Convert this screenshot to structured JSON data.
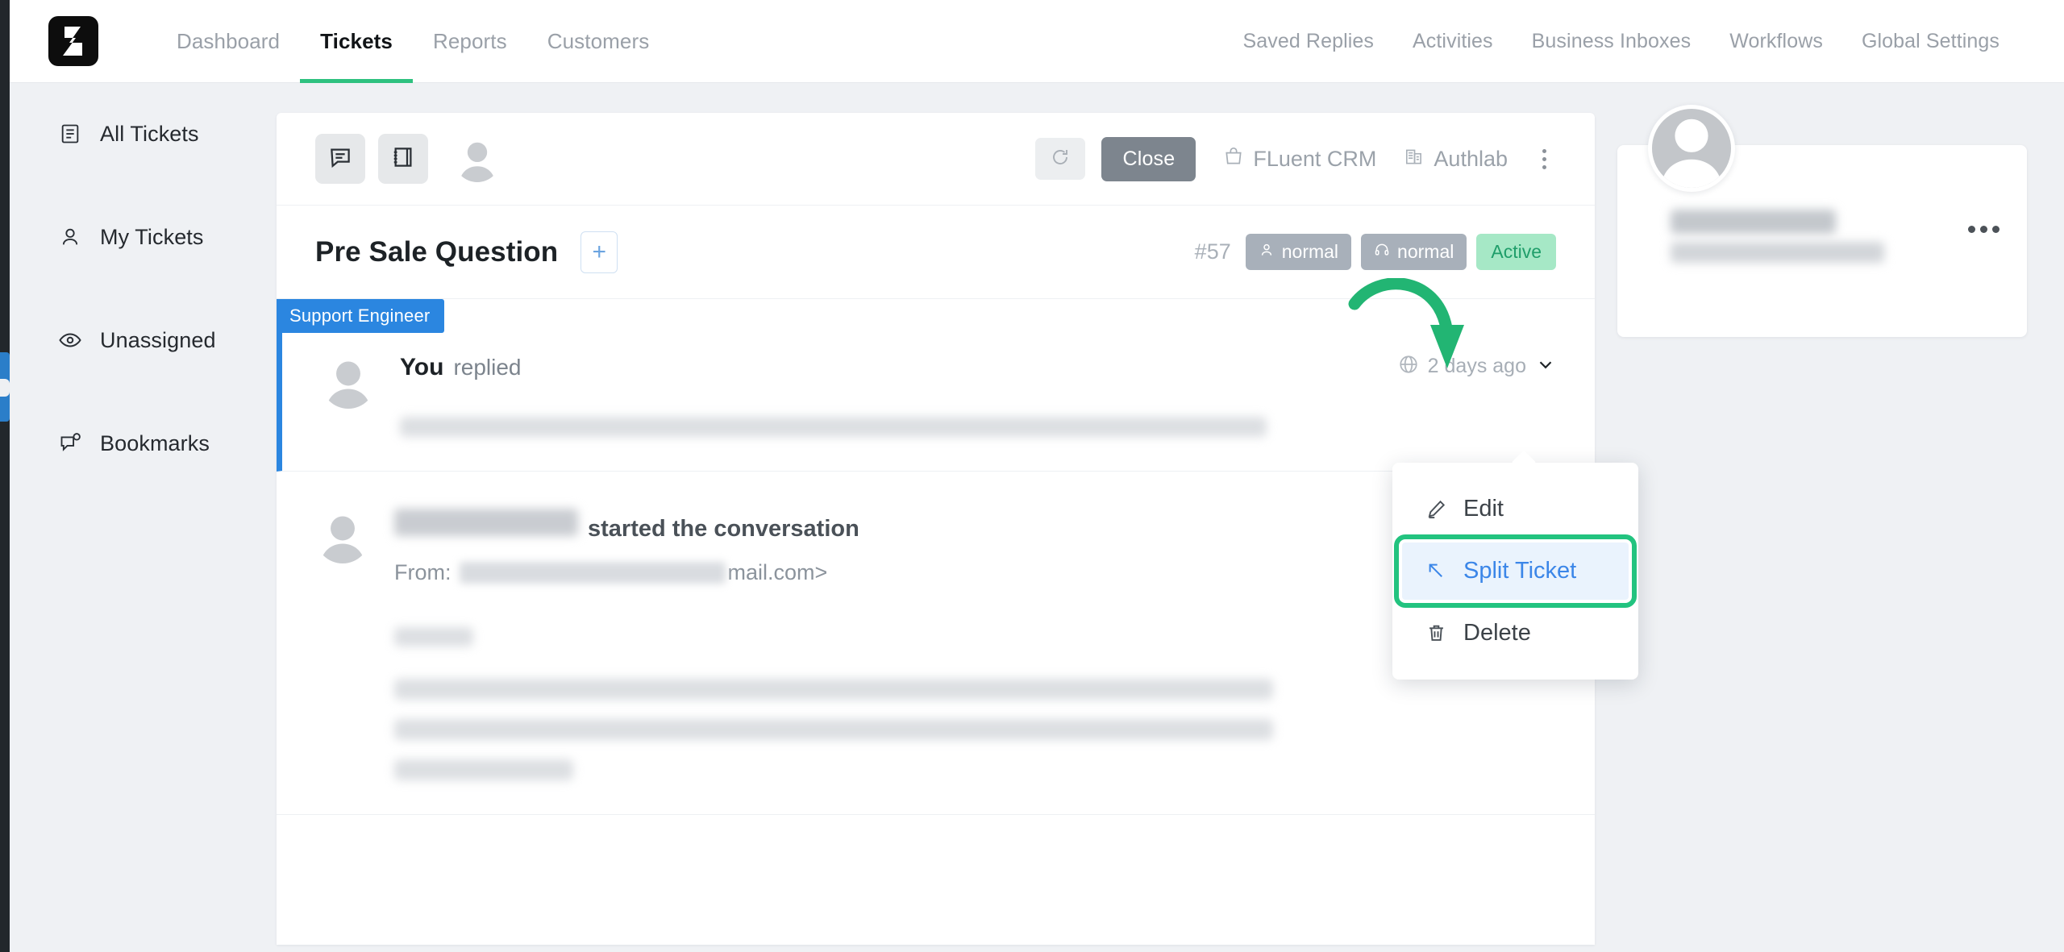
{
  "brand": {
    "logo_icon": "fluent-support-logo",
    "accent_green": "#2ec17f",
    "accent_blue": "#2b86e0",
    "highlight_green": "#22c37f"
  },
  "topnav": {
    "left_items": [
      {
        "label": "Dashboard",
        "active": false
      },
      {
        "label": "Tickets",
        "active": true
      },
      {
        "label": "Reports",
        "active": false
      },
      {
        "label": "Customers",
        "active": false
      }
    ],
    "right_items": [
      {
        "label": "Saved Replies"
      },
      {
        "label": "Activities"
      },
      {
        "label": "Business Inboxes"
      },
      {
        "label": "Workflows"
      },
      {
        "label": "Global Settings"
      }
    ]
  },
  "sidebar": {
    "items": [
      {
        "label": "All Tickets",
        "icon": "document-list-icon"
      },
      {
        "label": "My Tickets",
        "icon": "user-icon"
      },
      {
        "label": "Unassigned",
        "icon": "eye-icon"
      },
      {
        "label": "Bookmarks",
        "icon": "bookmark-chat-icon"
      }
    ]
  },
  "toolbar": {
    "conversation_icon": "chat-bubble-icon",
    "notes_icon": "notebook-icon",
    "avatar_icon": "avatar-placeholder-icon",
    "refresh_icon": "refresh-icon",
    "close_label": "Close",
    "links": [
      {
        "label": "FLuent CRM",
        "icon": "shopping-bag-icon"
      },
      {
        "label": "Authlab",
        "icon": "building-icon"
      }
    ],
    "more_icon": "kebab-menu-icon"
  },
  "ticket": {
    "title": "Pre Sale Question",
    "add_label": "+",
    "number": "#57",
    "badges": [
      {
        "label": "normal",
        "icon": "user-icon",
        "kind": "priority"
      },
      {
        "label": "normal",
        "icon": "headset-icon",
        "kind": "support"
      },
      {
        "label": "Active",
        "icon": "",
        "kind": "status"
      }
    ]
  },
  "conversation": {
    "messages": [
      {
        "role_badge": "Support Engineer",
        "author": "You",
        "action": "replied",
        "time": "2 days ago",
        "time_icon": "globe-icon",
        "caret_icon": "chevron-down-icon",
        "body_redacted": true
      },
      {
        "role_badge": "",
        "author": "",
        "author_redacted": true,
        "action": "started the conversation",
        "from_label": "From:",
        "from_email_suffix": "mail.com>",
        "channel_icon": "envelope-icon",
        "body_redacted": true
      }
    ]
  },
  "dropdown": {
    "items": [
      {
        "label": "Edit",
        "icon": "pencil-icon",
        "highlighted": false
      },
      {
        "label": "Split Ticket",
        "icon": "arrow-up-left-icon",
        "highlighted": true
      },
      {
        "label": "Delete",
        "icon": "trash-icon",
        "highlighted": false
      }
    ]
  },
  "annotation": {
    "arrow_icon": "curved-down-arrow-annotation",
    "arrow_color": "#22b573",
    "highlight_box_color": "#22c37f"
  },
  "right_panel": {
    "avatar_icon": "avatar-placeholder-icon",
    "name_redacted": true,
    "email_redacted": true,
    "more_icon": "ellipsis-icon"
  }
}
